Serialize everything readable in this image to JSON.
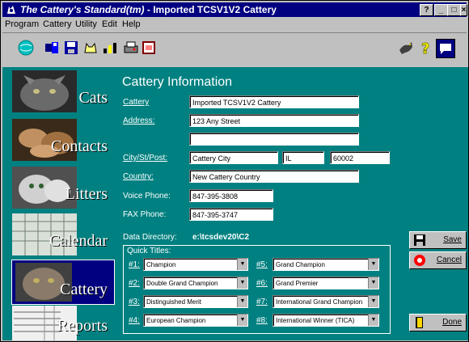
{
  "window": {
    "title_italic": "The Cattery's Standard(tm)",
    "title_rest": " - Imported TCSV1V2 Cattery",
    "caption_buttons": [
      "?",
      "_",
      "□",
      "×"
    ]
  },
  "menu": [
    "Program",
    "Cattery",
    "Utility",
    "Edit",
    "Help"
  ],
  "toolbar": {
    "icons": [
      "globe-icon",
      "save-pedigree-icon",
      "save-icon",
      "cat-icon",
      "chart-icon",
      "print-icon",
      "calendar-icon"
    ],
    "right_icons": [
      "cat-walking-icon",
      "help-icon",
      "chat-icon"
    ]
  },
  "nav": [
    {
      "label": "Cats",
      "icon": "cats-photo-icon"
    },
    {
      "label": "Contacts",
      "icon": "contacts-photo-icon"
    },
    {
      "label": "Litters",
      "icon": "litters-photo-icon"
    },
    {
      "label": "Calendar",
      "icon": "calendar-photo-icon"
    },
    {
      "label": "Cattery",
      "icon": "cattery-photo-icon",
      "selected": true
    },
    {
      "label": "Reports",
      "icon": "reports-photo-icon"
    }
  ],
  "form": {
    "heading": "Cattery Information",
    "cattery_label": "Cattery",
    "cattery_value": "Imported TCSV1V2 Cattery",
    "address_label": "Address:",
    "address_line1": "123 Any Street",
    "address_line2": "",
    "city_label": "City/St/Post:",
    "city_value": "Cattery City",
    "state_value": "IL",
    "post_value": "60002",
    "country_label": "Country:",
    "country_value": "New Cattery Country",
    "voice_label": "Voice Phone:",
    "voice_value": "847-395-3808",
    "fax_label": "FAX Phone:",
    "fax_value": "847-395-3747",
    "datadir_label": "Data Directory:",
    "datadir_value": "e:\\tcsdev20\\C2"
  },
  "quick_titles": {
    "label": "Quick Titles:",
    "items": [
      {
        "key": "#1:",
        "value": "Champion"
      },
      {
        "key": "#2:",
        "value": "Double Grand Champion"
      },
      {
        "key": "#3:",
        "value": "Distinguished Merit"
      },
      {
        "key": "#4:",
        "value": "European Champion"
      },
      {
        "key": "#5:",
        "value": "Grand Champion"
      },
      {
        "key": "#6:",
        "value": "Grand Premier"
      },
      {
        "key": "#7:",
        "value": "International Grand Champion"
      },
      {
        "key": "#8:",
        "value": "International Winner (TICA)"
      }
    ]
  },
  "buttons": {
    "save": "Save",
    "cancel": "Cancel",
    "done": "Done"
  }
}
